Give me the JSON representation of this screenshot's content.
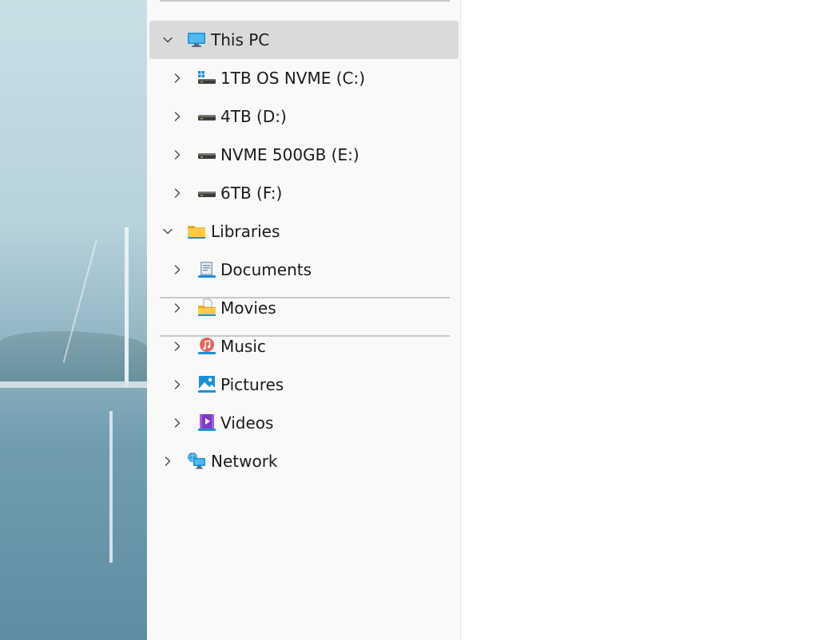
{
  "tree": {
    "this_pc": {
      "label": "This PC",
      "expanded": true
    },
    "drives": [
      {
        "label": "1TB OS NVME (C:)",
        "icon": "os-drive-icon"
      },
      {
        "label": "4TB (D:)",
        "icon": "drive-icon"
      },
      {
        "label": "NVME 500GB (E:)",
        "icon": "drive-icon"
      },
      {
        "label": "6TB (F:)",
        "icon": "drive-icon"
      }
    ],
    "libraries": {
      "label": "Libraries",
      "expanded": true
    },
    "library_items": [
      {
        "label": "Documents",
        "icon": "documents-icon"
      },
      {
        "label": "Movies",
        "icon": "movies-folder-icon"
      },
      {
        "label": "Music",
        "icon": "music-icon"
      },
      {
        "label": "Pictures",
        "icon": "pictures-icon"
      },
      {
        "label": "Videos",
        "icon": "videos-icon"
      }
    ],
    "network": {
      "label": "Network",
      "expanded": false
    }
  },
  "colors": {
    "selected_row": "#dadada",
    "nav_background": "#f9f9f9",
    "text": "#1a1a1a"
  }
}
